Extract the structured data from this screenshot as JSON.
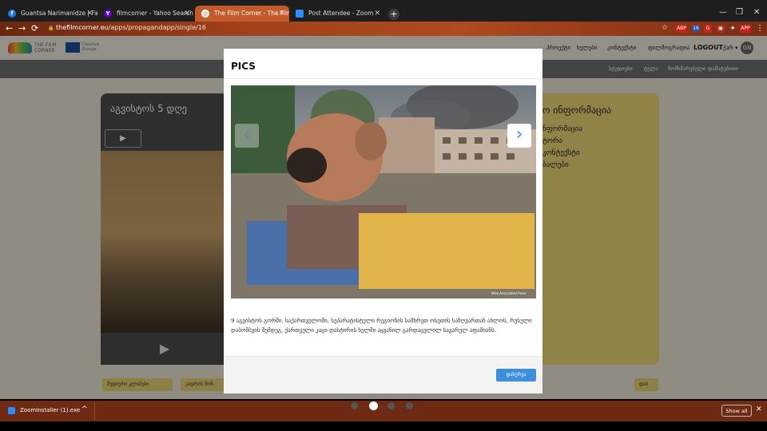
{
  "browser": {
    "tabs": [
      {
        "title": "Guantsa Narimanidze | Facebook",
        "icon": "facebook-icon",
        "color": "#1877f2",
        "glyph": "f"
      },
      {
        "title": "filmcorner - Yahoo Search Resul",
        "icon": "yahoo-icon",
        "color": "#6001d2",
        "glyph": "Y"
      },
      {
        "title": "The Film Corner - The Film Corne",
        "icon": "globe-icon",
        "color": "#e0602a",
        "glyph": "◎"
      },
      {
        "title": "Post Attendee - Zoom",
        "icon": "zoom-icon",
        "color": "#2d8cff",
        "glyph": "▪"
      }
    ],
    "tab_close": "✕",
    "new_tab": "+",
    "window_controls": {
      "minimize": "—",
      "maximize": "❐",
      "close": "✕"
    },
    "nav": {
      "back": "←",
      "forward": "→",
      "reload": "⟳",
      "lock": "🔒"
    },
    "url_host": "thefilmcorner.eu",
    "url_path": "/apps/propagandapp/single/16",
    "star": "☆",
    "extensions": [
      {
        "label": "ABP",
        "color": "#c8201d"
      },
      {
        "label": "16",
        "color": "#2e4fa6"
      },
      {
        "label": "G",
        "color": "#c22"
      },
      {
        "label": "▣",
        "color": "#b02a2a"
      },
      {
        "label": "✚",
        "color": "#444"
      },
      {
        "label": "APP",
        "color": "#c8201d"
      }
    ],
    "menu": "⋮"
  },
  "site": {
    "logo_text_1": "THE FILM",
    "logo_text_2": "CORNER",
    "eu_text_1": "Creative",
    "eu_text_2": "Europe",
    "topnav": [
      "პროექტი",
      "ხელები",
      "კონტექსტი",
      "ფილმოგრაფია"
    ],
    "logout": "LOGOUT",
    "lang": "ქარ ▾",
    "avatar": "GN",
    "subnav": [
      "სტუდიები",
      "ტულა",
      "მომხმარებელი",
      "დამატებითი"
    ]
  },
  "left_card": {
    "title": "აგვისტოს 5 დღე",
    "play": "▶",
    "big_play": "▶"
  },
  "right_card": {
    "title": "ო ინფორმაცია",
    "items": [
      "ნფორმაცია",
      "ტორა",
      "კონტექსტი",
      "ბალები"
    ]
  },
  "chips": [
    "მედიური კლიპები",
    "კადრის მონ",
    "დაბ"
  ],
  "modal": {
    "title": "PICS",
    "prev": "‹",
    "next": "›",
    "photo_credit": "Wire Associated Press",
    "caption": "9 აგვისტოს გორში. საქართველოში, სეპარატისტული რეგიონის სამხრეთ ოსეთის საზღვართან ახლოს, რუსული დაბომბვის შემდეგ, ქართველი კაცი დასტირის ხელში აყვანილ გარდაცვლილ სავარელ აფაშიანს.",
    "close": "დახურვა"
  },
  "carousel_dots": {
    "count": 4,
    "active": 1
  },
  "download_bar": {
    "file": "ZoomInstaller (1).exe",
    "chevron": "^",
    "show_all": "Show all",
    "close": "✕"
  }
}
